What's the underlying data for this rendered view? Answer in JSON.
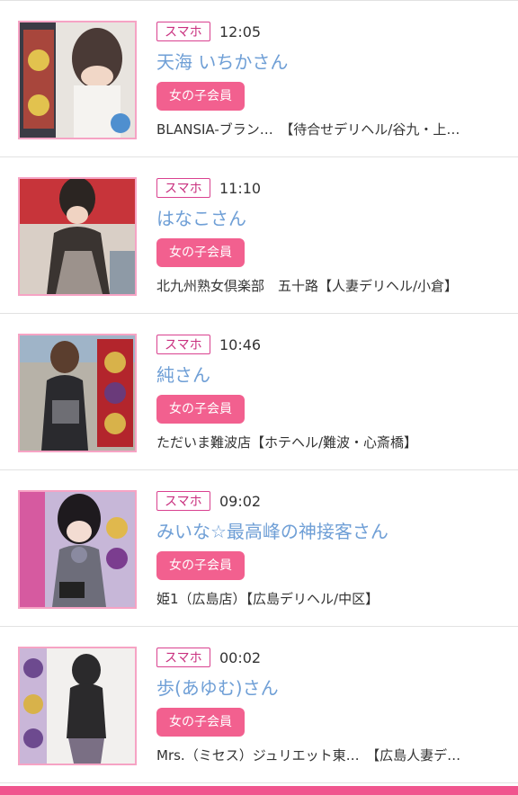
{
  "entries": [
    {
      "device": "スマホ",
      "time": "12:05",
      "name": "天海 いちかさん",
      "member": "女の子会員",
      "shop": "BLANSIA-ブラン…　【待合せデリヘル/谷九・上…",
      "photo_colors": [
        "#3b3b45",
        "#e8e4df",
        "#c44a3a"
      ]
    },
    {
      "device": "スマホ",
      "time": "11:10",
      "name": "はなこさん",
      "member": "女の子会員",
      "shop": "北九州熟女倶楽部　五十路【人妻デリヘル/小倉】",
      "photo_colors": [
        "#c7343a",
        "#3a3431",
        "#d9cfc6"
      ]
    },
    {
      "device": "スマホ",
      "time": "10:46",
      "name": "純さん",
      "member": "女の子会員",
      "shop": "ただいま難波店【ホテヘル/難波・心斎橋】",
      "photo_colors": [
        "#b7b2a8",
        "#2a2a2e",
        "#b3252c"
      ]
    },
    {
      "device": "スマホ",
      "time": "09:02",
      "name": "みいな☆最高峰の神接客さん",
      "member": "女の子会員",
      "shop": "姫1（広島店）【広島デリヘル/中区】",
      "photo_colors": [
        "#d65aa0",
        "#c7b7d8",
        "#6d6d7a"
      ]
    },
    {
      "device": "スマホ",
      "time": "00:02",
      "name": "歩(あゆむ)さん",
      "member": "女の子会員",
      "shop": "Mrs.（ミセス）ジュリエット東…　【広島人妻デ…",
      "photo_colors": [
        "#f2f0ee",
        "#2b2a2c",
        "#c9b6d8"
      ]
    }
  ],
  "accent_color": "#f0558e"
}
